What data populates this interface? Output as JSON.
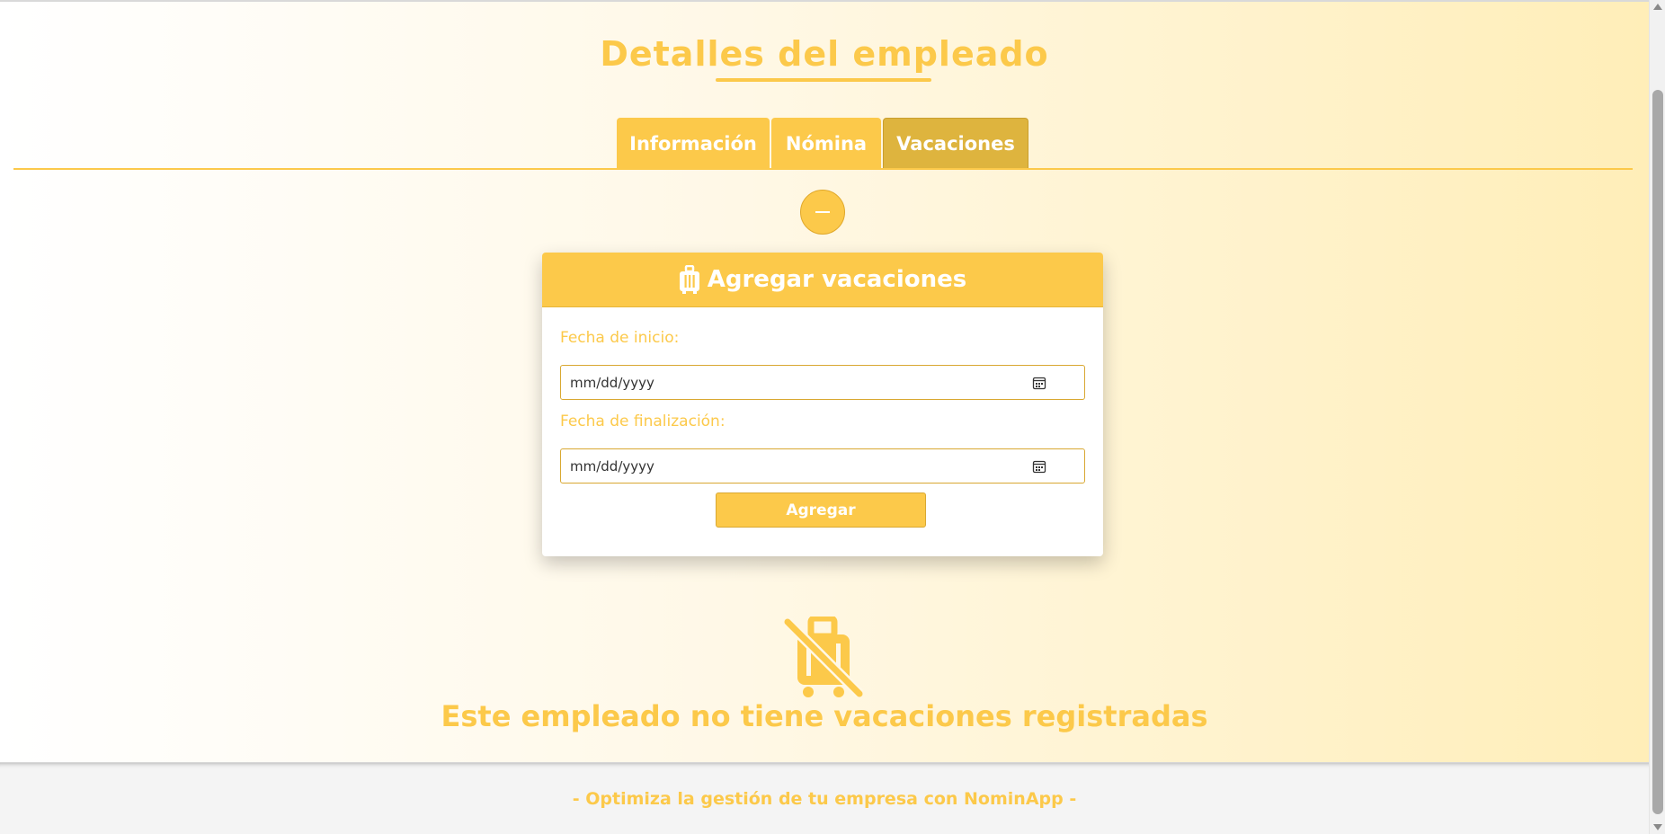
{
  "page": {
    "title": "Detalles del empleado"
  },
  "tabs": [
    {
      "label": "Información"
    },
    {
      "label": "Nómina"
    },
    {
      "label": "Vacaciones",
      "active": true
    }
  ],
  "form": {
    "header": "Agregar vacaciones",
    "header_icon": "suitcase-icon",
    "start_label": "Fecha de inicio:",
    "start_placeholder": "mm/dd/yyyy",
    "end_label": "Fecha de finalización:",
    "end_placeholder": "mm/dd/yyyy",
    "submit_label": "Agregar"
  },
  "empty_state": {
    "icon": "no-luggage-icon",
    "message": "Este empleado no tiene vacaciones registradas"
  },
  "footer": {
    "text": "- Optimiza la gestión de tu empresa con NominApp -"
  },
  "colors": {
    "accent": "#fcc94a",
    "accent_dark": "#deb43e",
    "footer_bg": "#f4f4f4"
  }
}
